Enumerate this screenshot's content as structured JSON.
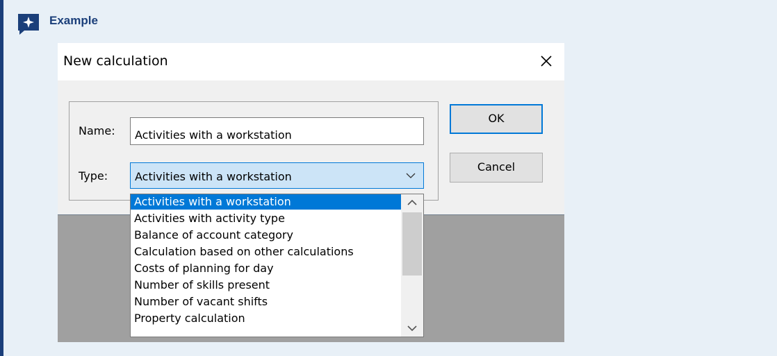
{
  "callout": {
    "title": "Example",
    "icon": "sparkle-icon",
    "accent_color": "#1b3f7a",
    "background_color": "#e8f0f7"
  },
  "dialog": {
    "title": "New calculation",
    "close_icon": "close-icon",
    "name_label": "Name:",
    "name_value": "Activities with a workstation",
    "type_label": "Type:",
    "type_selected": "Activities with a workstation",
    "ok_label": "OK",
    "cancel_label": "Cancel",
    "highlight_color": "#0078d7"
  },
  "dropdown": {
    "items": [
      "Activities with a workstation",
      "Activities with activity type",
      "Balance of account category",
      "Calculation based on other calculations",
      "Costs of planning for day",
      "Number of skills present",
      "Number of vacant shifts",
      "Property calculation"
    ],
    "selected_index": 0
  }
}
